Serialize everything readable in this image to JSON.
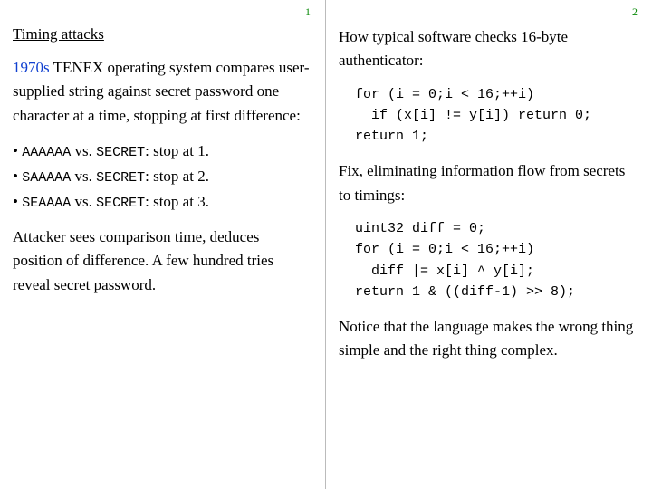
{
  "left": {
    "pagenum": "1",
    "title": "Timing attacks",
    "year_link": "1970s",
    "para1_rest": "  TENEX operating system compares user-supplied string against secret password one character at a time, stopping at first difference:",
    "bullets": [
      {
        "pre": "• ",
        "code": "AAAAAA",
        "mid": " vs. ",
        "secret": "SECRET",
        "post": ": stop at 1."
      },
      {
        "pre": "• ",
        "code": "SAAAAA",
        "mid": " vs. ",
        "secret": "SECRET",
        "post": ": stop at 2."
      },
      {
        "pre": "• ",
        "code": "SEAAAA",
        "mid": " vs. ",
        "secret": "SECRET",
        "post": ": stop at 3."
      }
    ],
    "para2": "Attacker sees comparison time, deduces position of difference. A few hundred tries reveal secret password."
  },
  "right": {
    "pagenum": "2",
    "para1": "How typical software checks 16-byte authenticator:",
    "code1": "for (i = 0;i < 16;++i)\n  if (x[i] != y[i]) return 0;\nreturn 1;",
    "para2": "Fix, eliminating information flow from secrets to timings:",
    "code2": "uint32 diff = 0;\nfor (i = 0;i < 16;++i)\n  diff |= x[i] ^ y[i];\nreturn 1 & ((diff-1) >> 8);",
    "para3": "Notice that the language makes the wrong thing simple and the right thing complex."
  }
}
